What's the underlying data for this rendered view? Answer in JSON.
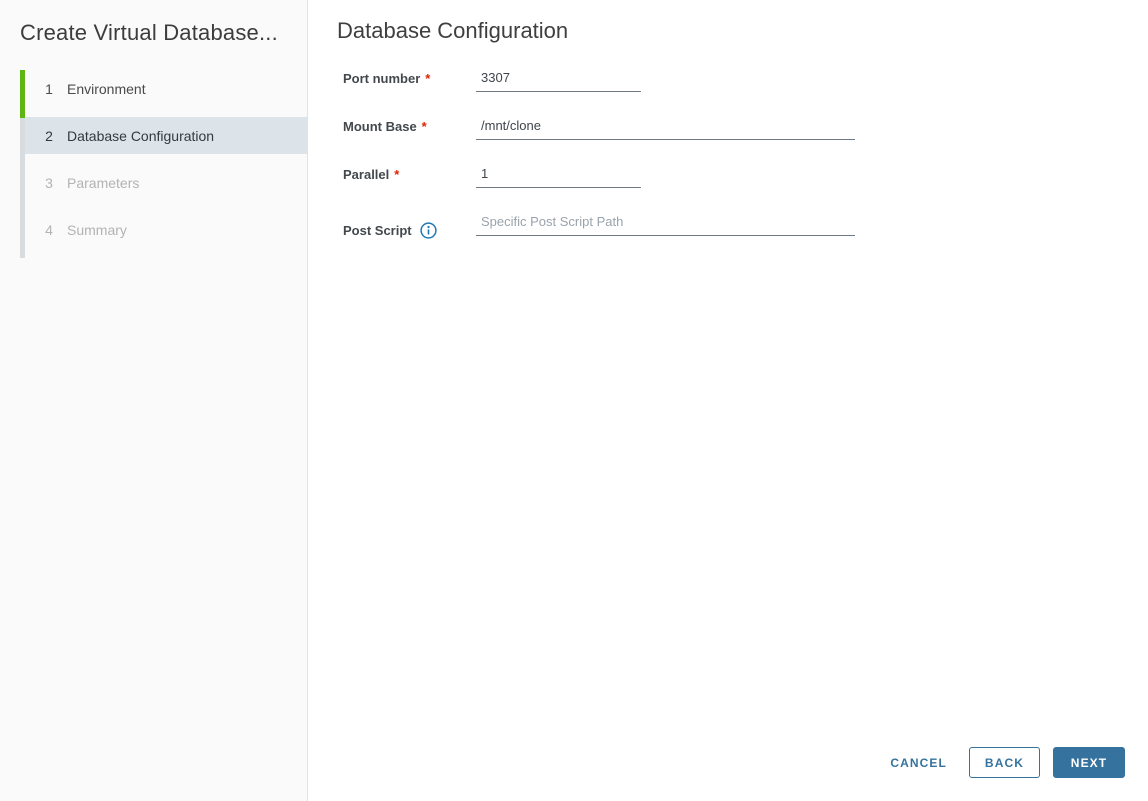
{
  "colors": {
    "accent_blue": "#35739e",
    "step_done_green": "#60b515",
    "step_current_bg": "#dce4ea",
    "required_red": "#e12200",
    "info_icon_blue": "#2178b5",
    "sidebar_bg": "#fafafa"
  },
  "sidebar": {
    "title": "Create Virtual Database...",
    "steps": [
      {
        "number": "1",
        "label": "Environment",
        "state": "complete"
      },
      {
        "number": "2",
        "label": "Database Configuration",
        "state": "current"
      },
      {
        "number": "3",
        "label": "Parameters",
        "state": "disabled"
      },
      {
        "number": "4",
        "label": "Summary",
        "state": "disabled"
      }
    ]
  },
  "main": {
    "heading": "Database Configuration",
    "required_marker": "*",
    "fields": [
      {
        "label": "Port number",
        "required": true,
        "value": "3307",
        "placeholder": ""
      },
      {
        "label": "Mount Base",
        "required": true,
        "value": "/mnt/clone",
        "placeholder": ""
      },
      {
        "label": "Parallel",
        "required": true,
        "value": "1",
        "placeholder": ""
      },
      {
        "label": "Post Script",
        "required": false,
        "value": "",
        "placeholder": "Specific Post Script Path"
      }
    ]
  },
  "footer": {
    "cancel": "CANCEL",
    "back": "BACK",
    "next": "NEXT"
  }
}
